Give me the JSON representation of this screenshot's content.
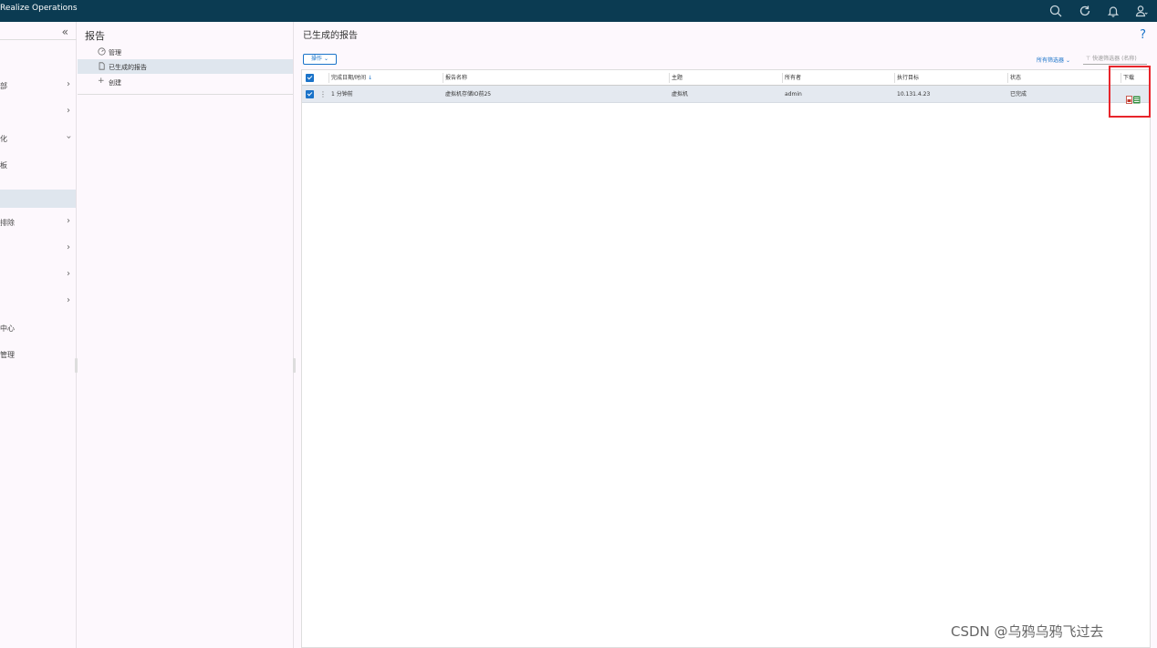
{
  "header": {
    "app_title": "Realize Operations",
    "icons": [
      "search-icon",
      "refresh-icon",
      "bell-icon",
      "user-icon"
    ]
  },
  "sidebar": {
    "collapse_glyph": "«",
    "items": [
      {
        "label": "部"
      },
      {
        "label": ""
      },
      {
        "label": "化"
      },
      {
        "label": "板"
      },
      {
        "label": ""
      },
      {
        "label": "排除"
      },
      {
        "label": ""
      },
      {
        "label": ""
      },
      {
        "label": ""
      },
      {
        "label": "中心"
      },
      {
        "label": "管理"
      }
    ]
  },
  "reports_panel": {
    "title": "报告",
    "items": [
      {
        "label": "管理",
        "icon": "dashboard-icon"
      },
      {
        "label": "已生成的报告",
        "icon": "document-icon"
      },
      {
        "label": "创建",
        "icon": "plus-icon"
      }
    ]
  },
  "main": {
    "title": "已生成的报告",
    "help": "?",
    "actions_label": "操作",
    "all_filters_label": "所有筛选器",
    "quick_filter_placeholder": "快速筛选器 (名称)",
    "columns": [
      "完成日期/时间",
      "报告名称",
      "主题",
      "所有者",
      "执行目标",
      "状态",
      "下载"
    ],
    "rows": [
      {
        "completed": "1 分钟前",
        "name": "虚拟机存储IO前25",
        "subject": "虚拟机",
        "owner": "admin",
        "target": "10.131.4.23",
        "status": "已完成",
        "download_formats": [
          "pdf-icon",
          "csv-icon"
        ]
      }
    ]
  },
  "watermark": "CSDN @乌鸦乌鸦飞过去",
  "colors": {
    "topbar": "#0b3b52",
    "accent": "#1a73c9",
    "highlight": "#e8252b",
    "selected_row": "#e4e9f0"
  }
}
